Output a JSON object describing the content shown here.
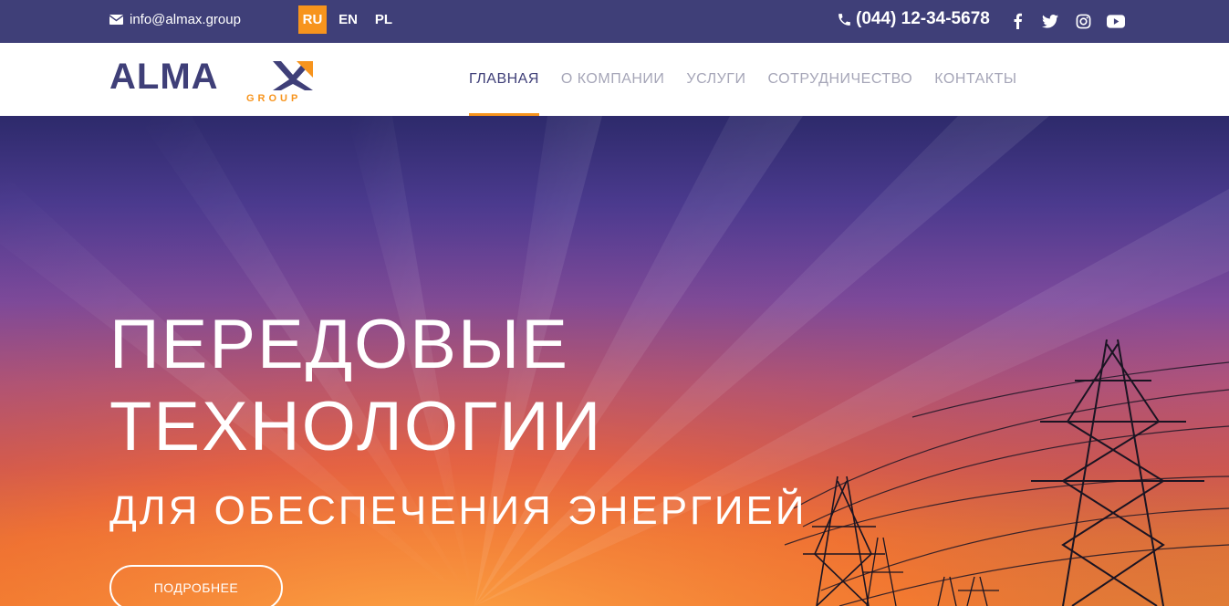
{
  "topbar": {
    "email": "info@almax.group",
    "languages": [
      {
        "code": "RU",
        "active": true
      },
      {
        "code": "EN",
        "active": false
      },
      {
        "code": "PL",
        "active": false
      }
    ],
    "phone": "(044) 12-34-5678",
    "socials": [
      "facebook-icon",
      "twitter-icon",
      "instagram-icon",
      "youtube-icon"
    ]
  },
  "logo": {
    "main": "ALMAX",
    "sub": "GROUP"
  },
  "nav": {
    "items": [
      {
        "label": "ГЛАВНАЯ",
        "active": true
      },
      {
        "label": "О КОМПАНИИ",
        "active": false
      },
      {
        "label": "УСЛУГИ",
        "active": false
      },
      {
        "label": "СОТРУДНИЧЕСТВО",
        "active": false
      },
      {
        "label": "КОНТАКТЫ",
        "active": false
      }
    ]
  },
  "hero": {
    "title_line1": "ПЕРЕДОВЫЕ",
    "title_line2": "ТЕХНОЛОГИИ",
    "subtitle": "ДЛЯ ОБЕСПЕЧЕНИЯ ЭНЕРГИЕЙ",
    "button": "ПОДРОБНЕЕ"
  },
  "colors": {
    "topbar": "#3f3f78",
    "accent": "#f7941d",
    "nav_inactive": "#a6a6b8"
  }
}
